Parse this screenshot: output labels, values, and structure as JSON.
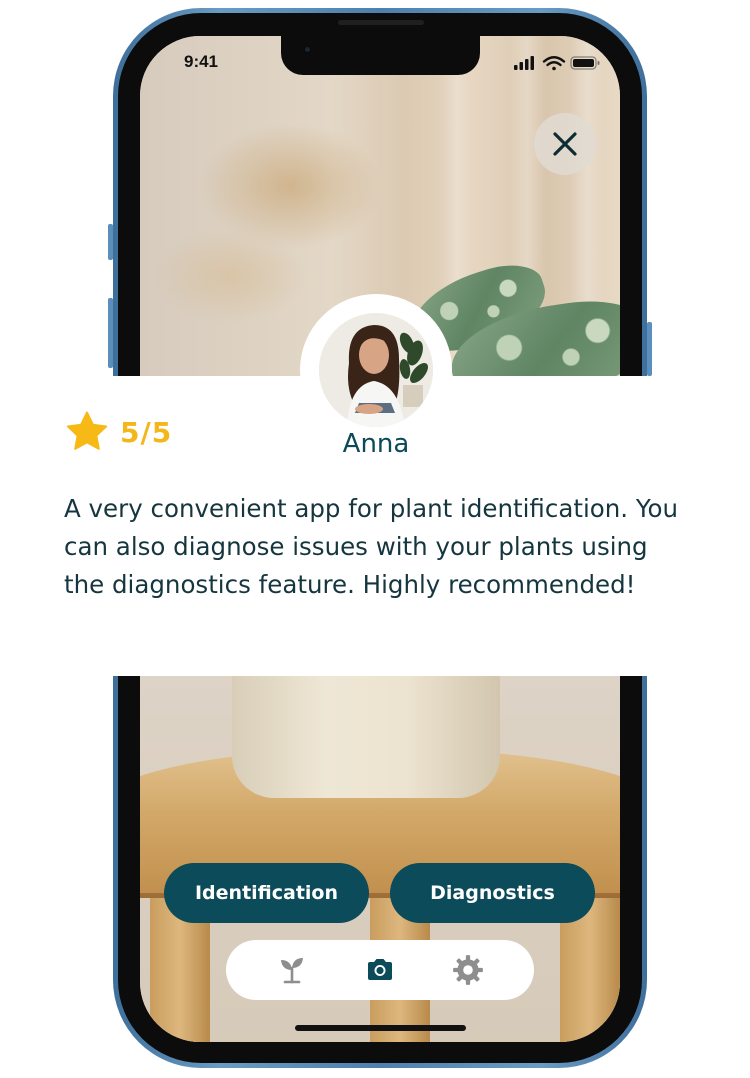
{
  "status_bar": {
    "time": "9:41"
  },
  "review": {
    "rating": "5/5",
    "reviewer_name": "Anna",
    "text": "A very convenient app for plant identification. You can also diagnose issues with your plants using the diagnostics feature. Highly recommended!"
  },
  "actions": {
    "identification_label": "Identification",
    "diagnostics_label": "Diagnostics"
  },
  "tab_bar": {
    "items": [
      {
        "icon": "sprout-icon",
        "active": false
      },
      {
        "icon": "camera-icon",
        "active": true
      },
      {
        "icon": "gear-icon",
        "active": false
      }
    ]
  },
  "colors": {
    "brand": "#0b4b5a",
    "star": "#f3b71b",
    "text": "#16363f",
    "inactive_icon": "#8e8e8e"
  }
}
